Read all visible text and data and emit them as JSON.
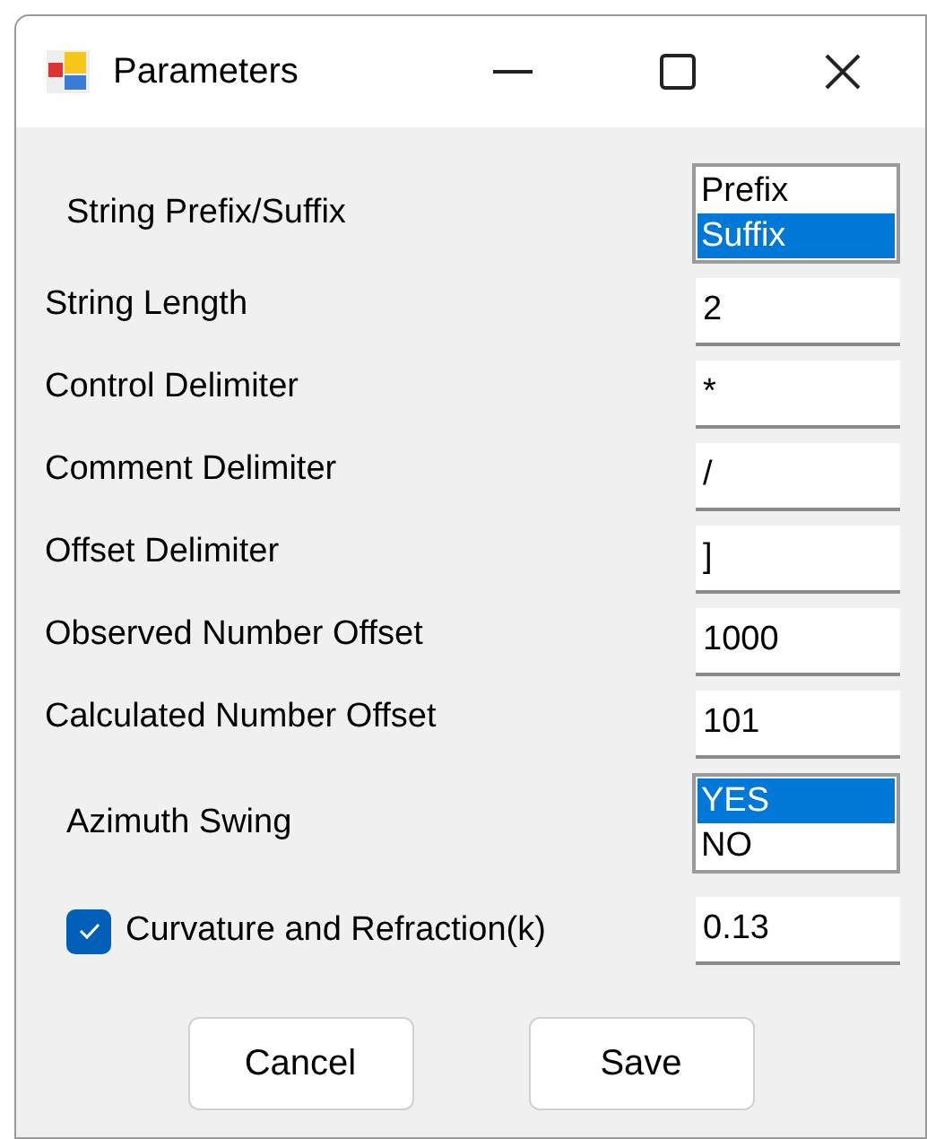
{
  "window": {
    "title": "Parameters"
  },
  "rows": [
    {
      "kind": "list",
      "label": "String Prefix/Suffix",
      "options": [
        {
          "label": "Prefix",
          "selected": false
        },
        {
          "label": "Suffix",
          "selected": true
        }
      ]
    },
    {
      "kind": "field",
      "label": "String Length",
      "value": "2"
    },
    {
      "kind": "field",
      "label": "Control Delimiter",
      "value": "*"
    },
    {
      "kind": "field",
      "label": "Comment Delimiter",
      "value": "/"
    },
    {
      "kind": "field",
      "label": "Offset Delimiter",
      "value": "]"
    },
    {
      "kind": "field",
      "label": "Observed Number Offset",
      "value": "1000"
    },
    {
      "kind": "field",
      "label": "Calculated Number Offset",
      "value": "101"
    },
    {
      "kind": "list",
      "label": "Azimuth Swing",
      "options": [
        {
          "label": "YES",
          "selected": true
        },
        {
          "label": "NO",
          "selected": false
        }
      ]
    },
    {
      "kind": "check",
      "label": "Curvature and Refraction(k)",
      "checked": true,
      "value": "0.13"
    }
  ],
  "buttons": [
    "Cancel",
    "Save"
  ]
}
